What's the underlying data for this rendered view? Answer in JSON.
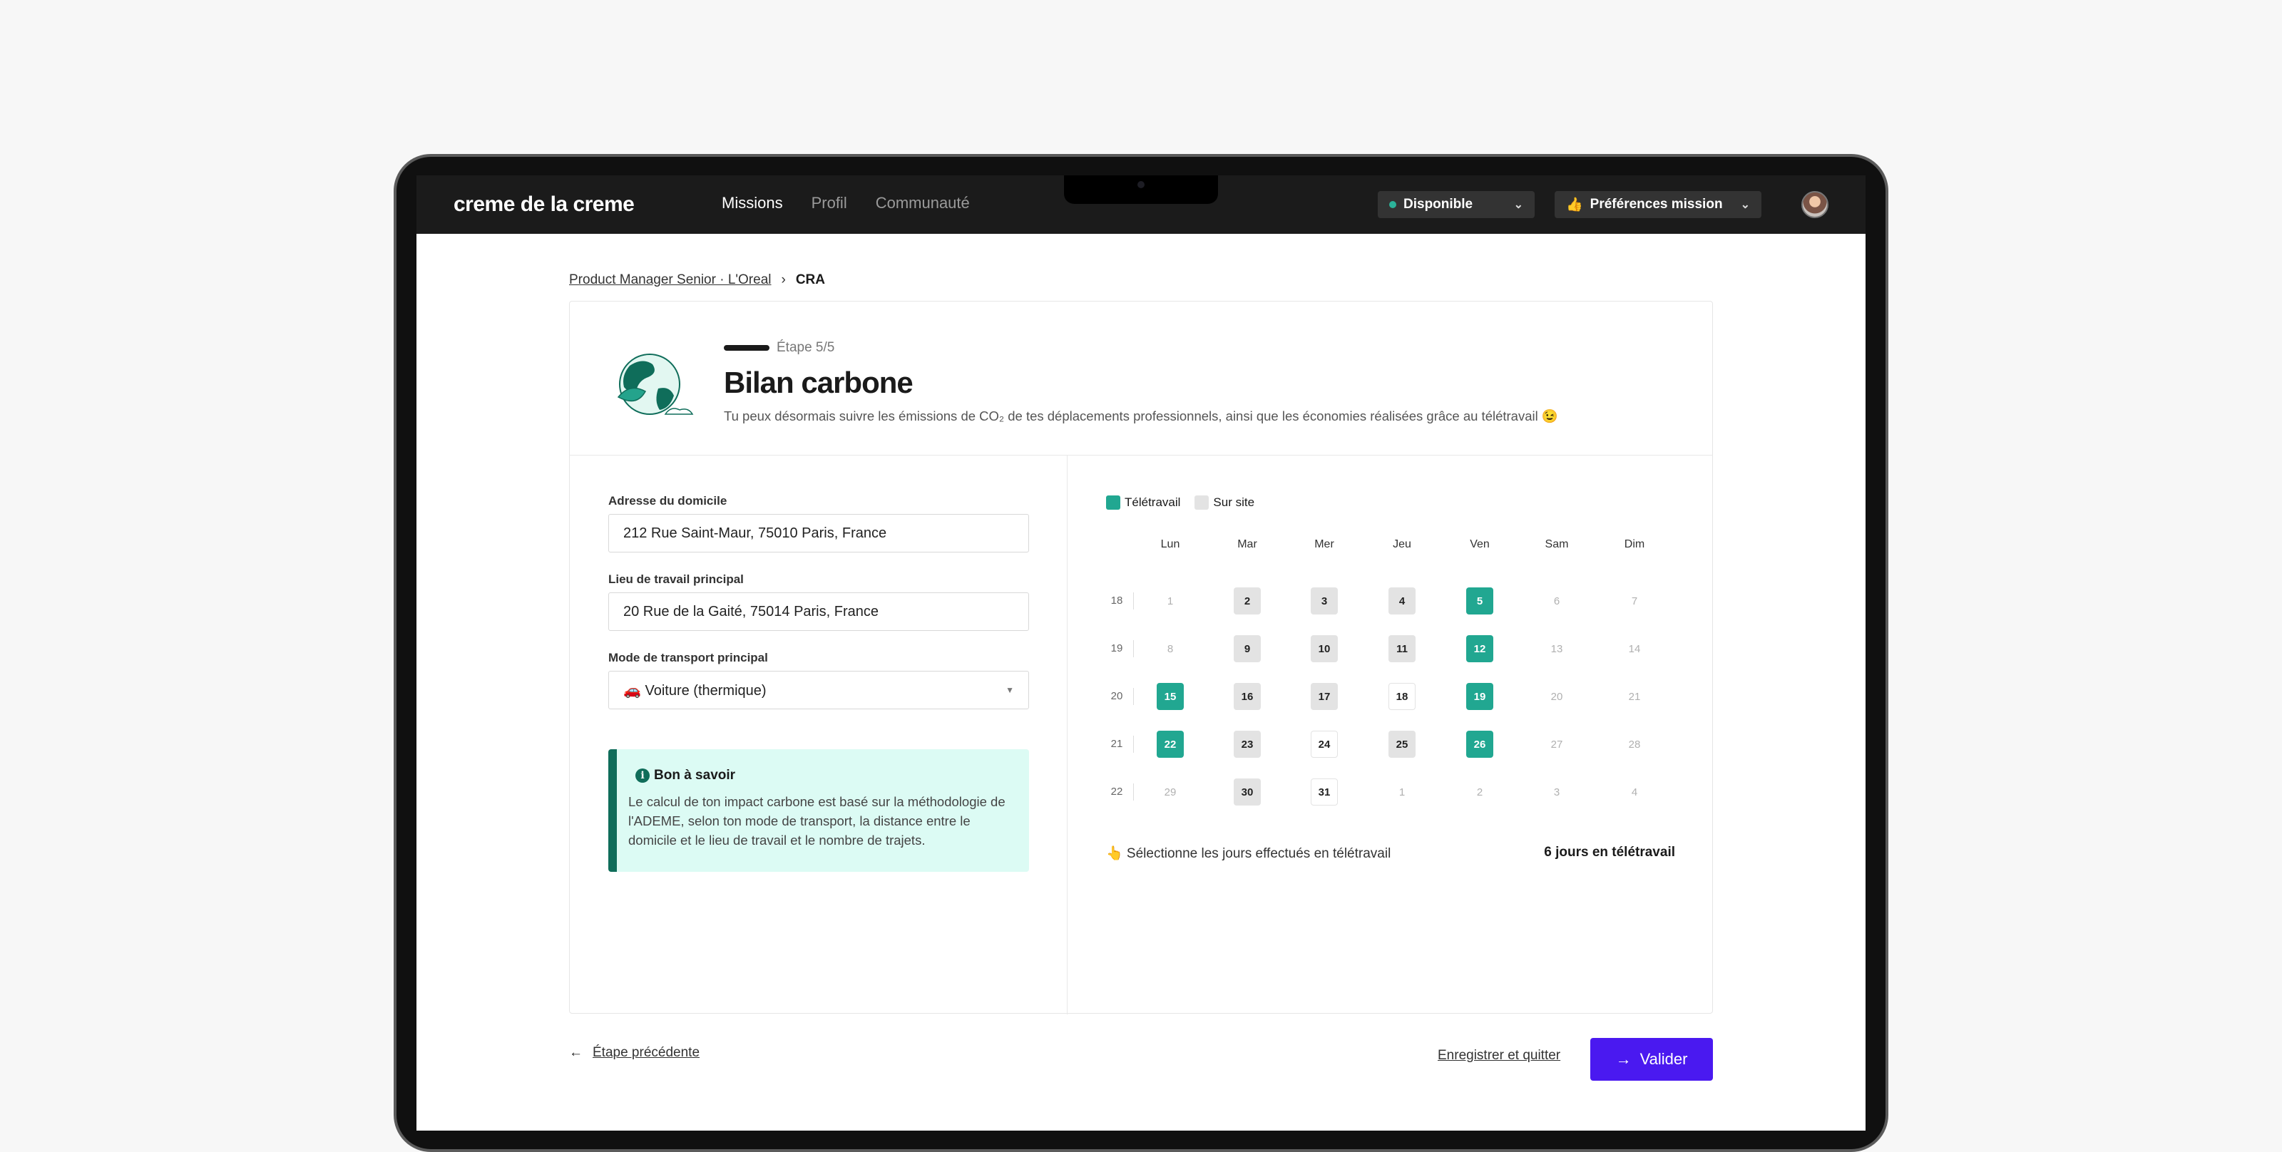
{
  "nav": {
    "logo": "creme de la creme",
    "links": [
      "Missions",
      "Profil",
      "Communauté"
    ],
    "status_label": "Disponible",
    "prefs_label": "Préférences mission"
  },
  "breadcrumb": {
    "parent": "Product Manager Senior · L'Oreal",
    "current": "CRA"
  },
  "header": {
    "step": "Étape 5/5",
    "title": "Bilan carbone",
    "subtitle": "Tu peux désormais suivre les émissions de CO₂ de tes déplacements professionnels, ainsi que les économies réalisées grâce au télétravail 😉"
  },
  "form": {
    "home_label": "Adresse du domicile",
    "home_value": "212 Rue Saint-Maur, 75010 Paris, France",
    "work_label": "Lieu de travail principal",
    "work_value": "20 Rue de la Gaité, 75014 Paris, France",
    "transport_label": "Mode de transport principal",
    "transport_value": "🚗 Voiture (thermique)"
  },
  "info": {
    "title": "Bon à savoir",
    "text": "Le calcul de ton impact carbone est basé sur la méthodologie de l'ADEME, selon ton mode de transport, la distance entre le domicile et le lieu de travail et le nombre de trajets."
  },
  "calendar": {
    "legend": {
      "tele": "Télétravail",
      "site": "Sur site"
    },
    "colors": {
      "tele": "#21a791",
      "site": "#e3e3e3"
    },
    "days": [
      "Lun",
      "Mar",
      "Mer",
      "Jeu",
      "Ven",
      "Sam",
      "Dim"
    ],
    "weeks": [
      {
        "num": "18",
        "days": [
          [
            "1",
            "muted"
          ],
          [
            "2",
            "site"
          ],
          [
            "3",
            "site"
          ],
          [
            "4",
            "site"
          ],
          [
            "5",
            "tele"
          ],
          [
            "6",
            "muted"
          ],
          [
            "7",
            "muted"
          ]
        ]
      },
      {
        "num": "19",
        "days": [
          [
            "8",
            "muted"
          ],
          [
            "9",
            "site"
          ],
          [
            "10",
            "site"
          ],
          [
            "11",
            "site"
          ],
          [
            "12",
            "tele"
          ],
          [
            "13",
            "muted"
          ],
          [
            "14",
            "muted"
          ]
        ]
      },
      {
        "num": "20",
        "days": [
          [
            "15",
            "tele"
          ],
          [
            "16",
            "site"
          ],
          [
            "17",
            "site"
          ],
          [
            "18",
            "plain"
          ],
          [
            "19",
            "tele"
          ],
          [
            "20",
            "muted"
          ],
          [
            "21",
            "muted"
          ]
        ]
      },
      {
        "num": "21",
        "days": [
          [
            "22",
            "tele"
          ],
          [
            "23",
            "site"
          ],
          [
            "24",
            "plain"
          ],
          [
            "25",
            "site"
          ],
          [
            "26",
            "tele"
          ],
          [
            "27",
            "muted"
          ],
          [
            "28",
            "muted"
          ]
        ]
      },
      {
        "num": "22",
        "days": [
          [
            "29",
            "muted"
          ],
          [
            "30",
            "site"
          ],
          [
            "31",
            "plain"
          ],
          [
            "1",
            "muted"
          ],
          [
            "2",
            "muted"
          ],
          [
            "3",
            "muted"
          ],
          [
            "4",
            "muted"
          ]
        ]
      }
    ],
    "hint": "👆 Sélectionne les jours effectués en télétravail",
    "count": "6 jours en télétravail"
  },
  "footer": {
    "back": "Étape précédente",
    "save": "Enregistrer et quitter",
    "validate": "Valider"
  }
}
